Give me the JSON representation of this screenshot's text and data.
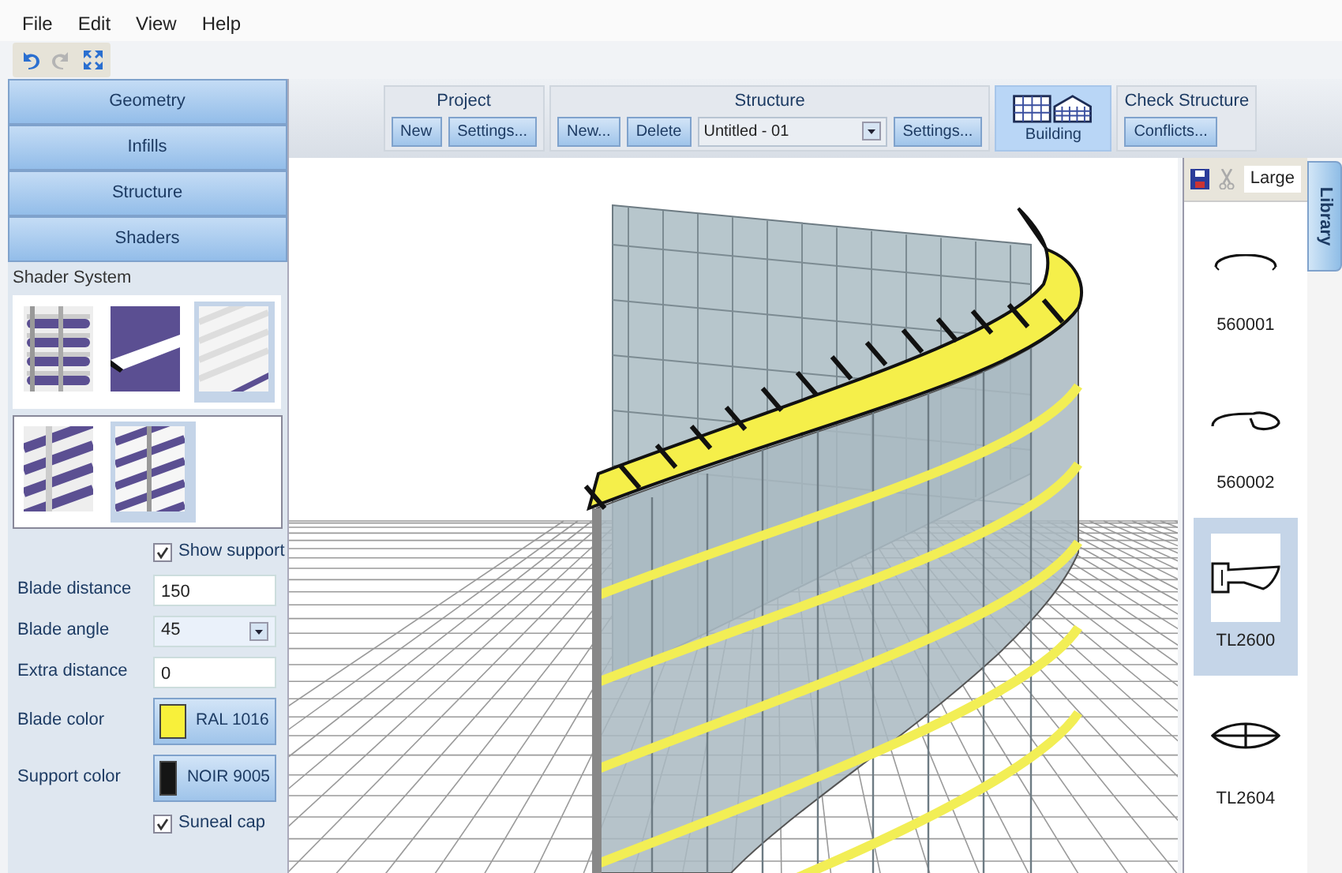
{
  "menu": [
    "File",
    "Edit",
    "View",
    "Help"
  ],
  "nav_buttons": [
    {
      "label": "Geometry"
    },
    {
      "label": "Infills"
    },
    {
      "label": "Structure"
    },
    {
      "label": "Shaders"
    }
  ],
  "shader_system": {
    "title": "Shader System",
    "groups": [
      {
        "options": [
          {
            "kind": "louvre",
            "selected": false
          },
          {
            "kind": "blade",
            "selected": false
          },
          {
            "kind": "slat",
            "selected": true
          }
        ]
      },
      {
        "options": [
          {
            "kind": "diagonal",
            "selected": false
          },
          {
            "kind": "diagonal-wide",
            "selected": true
          }
        ]
      }
    ]
  },
  "show_support": {
    "label": "Show support",
    "checked": true
  },
  "fields": [
    {
      "kind": "text",
      "label": "Blade distance",
      "value": "150"
    },
    {
      "kind": "select",
      "label": "Blade angle",
      "value": "45"
    },
    {
      "kind": "text",
      "label": "Extra distance",
      "value": "0"
    },
    {
      "kind": "color",
      "label": "Blade color",
      "value": "RAL 1016",
      "color": "#f8f03a"
    },
    {
      "kind": "color",
      "label": "Support color",
      "value": "NOIR 9005",
      "color": "#151515"
    }
  ],
  "suneal_cap": {
    "label": "Suneal cap",
    "checked": true
  },
  "ribbon": [
    {
      "kind": "group",
      "title": "Project",
      "items": [
        {
          "kind": "button",
          "label": "New"
        },
        {
          "kind": "button",
          "label": "Settings..."
        }
      ]
    },
    {
      "kind": "group",
      "title": "Structure",
      "items": [
        {
          "kind": "button",
          "label": "New..."
        },
        {
          "kind": "button",
          "label": "Delete"
        },
        {
          "kind": "select",
          "label": "Untitled - 01"
        },
        {
          "kind": "button",
          "label": "Settings..."
        }
      ]
    },
    {
      "kind": "big",
      "label": "Building",
      "selected": true
    },
    {
      "kind": "group",
      "title": "Check Structure",
      "items": [
        {
          "kind": "button",
          "label": "Conflicts..."
        }
      ]
    }
  ],
  "library": {
    "tab": "Library",
    "view_mode": "Large",
    "items": [
      {
        "kind": "arc",
        "label": "560001",
        "selected": false
      },
      {
        "kind": "hook",
        "label": "560002",
        "selected": false
      },
      {
        "kind": "bracket",
        "label": "TL2600",
        "selected": true
      },
      {
        "kind": "lens",
        "label": "TL2604",
        "selected": false
      }
    ]
  }
}
